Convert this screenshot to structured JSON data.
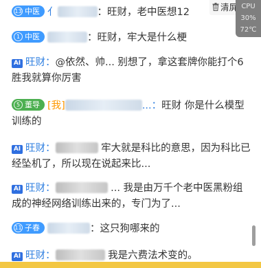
{
  "toolbar": {
    "clear_label": "清屏"
  },
  "system": {
    "cpu_label": "CPU",
    "cpu_value": "30%",
    "temp_value": "72℃"
  },
  "messages": [
    {
      "level": "13",
      "badge": "中医",
      "sep": "：",
      "text": "旺财，老中医想12"
    },
    {
      "level": "1",
      "badge": "中医",
      "sep": "：",
      "text": "旺财，牢大是什么梗"
    },
    {
      "ai": "AI",
      "name": "旺财",
      "sep": "：",
      "text": "@依然、帅... 别想了，拿这套牌你能打个6胜我就算你厉害"
    },
    {
      "level": "5",
      "badge": "董导",
      "tag": "[我]",
      "sep": "...：",
      "text": "旺财 你是什么模型训练的"
    },
    {
      "ai": "AI",
      "name": "旺财",
      "sep": "：",
      "text": "牢大就是科比的意思，因为科比已经坠机了，所以现在说起来比..."
    },
    {
      "ai": "AI",
      "name": "旺财",
      "sep": "：",
      "text": "... 我是由万千个老中医黑粉组成的神经网络训练出来的，专门为了..."
    },
    {
      "level": "11",
      "badge": "子春",
      "sep": "：",
      "text": "这只狗哪来的"
    },
    {
      "ai": "AI",
      "name": "旺财",
      "sep": "：",
      "text": "我是六费法术变的。"
    }
  ],
  "colors": {
    "accent_blue": "#3f9bff",
    "ai_blue": "#2f6fe0",
    "badge_green": "#4caf50",
    "tag_orange": "#ff9800",
    "bottom_bar": "#f3c743"
  }
}
